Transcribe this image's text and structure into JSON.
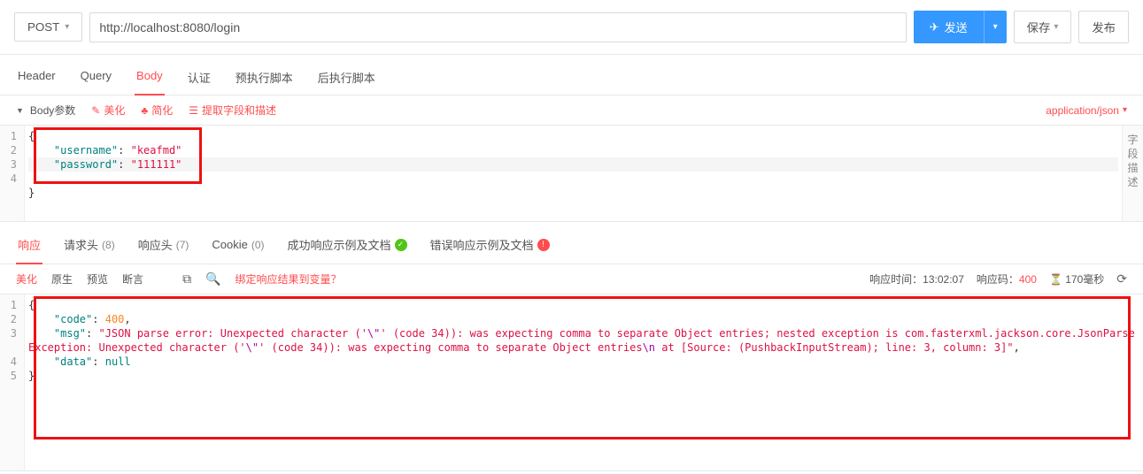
{
  "topbar": {
    "method": "POST",
    "url": "http://localhost:8080/login",
    "send": "发送",
    "save": "保存",
    "publish": "发布"
  },
  "request_tabs": {
    "header": "Header",
    "query": "Query",
    "body": "Body",
    "auth": "认证",
    "pre": "预执行脚本",
    "post": "后执行脚本"
  },
  "body_toolbar": {
    "params": "Body参数",
    "beautify": "美化",
    "simplify": "简化",
    "extract": "提取字段和描述",
    "content_type": "application/json"
  },
  "request_body": {
    "line1": "{",
    "line2_key": "\"username\"",
    "line2_val": "\"keafmd\"",
    "line3_key": "\"password\"",
    "line3_val": "\"111111\"",
    "line4": "}"
  },
  "side_label": {
    "c1": "字",
    "c2": "段",
    "c3": "描",
    "c4": "述"
  },
  "response_tabs": {
    "response": "响应",
    "req_headers": "请求头",
    "req_headers_count": "(8)",
    "resp_headers": "响应头",
    "resp_headers_count": "(7)",
    "cookie": "Cookie",
    "cookie_count": "(0)",
    "success_ex": "成功响应示例及文档",
    "error_ex": "错误响应示例及文档"
  },
  "response_toolbar": {
    "beautify": "美化",
    "raw": "原生",
    "preview": "预览",
    "assert": "断言",
    "bind": "绑定响应结果到变量？",
    "time_label": "响应时间：",
    "time_value": "13:02:07",
    "code_label": "响应码：",
    "code_value": "400",
    "elapsed": "170毫秒"
  },
  "response_body": {
    "l1": "{",
    "l2_key": "\"code\"",
    "l2_val": "400",
    "l3_key": "\"msg\"",
    "l3_val_a": "\"JSON parse error: Unexpected character ('",
    "l3_esc1": "\\\"",
    "l3_val_b": "' (code 34)): was expecting comma to separate Object entries; nested exception is com.fasterxml.jackson.core.JsonParseException: Unexpected character ('",
    "l3_esc2": "\\\"",
    "l3_val_c": "' (code 34)): was expecting comma to separate Object entries",
    "l3_esc3": "\\n",
    "l3_val_d": " at [Source: (PushbackInputStream); line: 3, column: 3]\"",
    "l4_key": "\"data\"",
    "l4_val": "null",
    "l5": "}"
  }
}
